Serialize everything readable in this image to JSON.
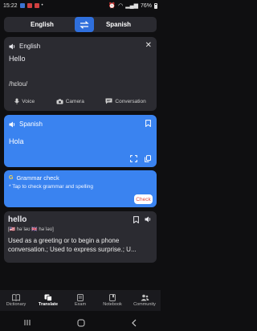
{
  "status": {
    "time": "15:22",
    "battery": "76%"
  },
  "lang_bar": {
    "source": "English",
    "target": "Spanish"
  },
  "source_card": {
    "language": "English",
    "text": "Hello",
    "phonetic": "/hɛlou/",
    "actions": [
      "Voice",
      "Camera",
      "Conversation"
    ]
  },
  "target_card": {
    "language": "Spanish",
    "text": "Hola"
  },
  "grammar": {
    "title": "Grammar check",
    "tip": "* Tap to check grammar and spelling",
    "button": "Check"
  },
  "dictionary": {
    "word": "hello",
    "phonetic": "[🇺🇸 həˈləʊ 🇬🇧 həˈləʊ]",
    "definition": "Used as a greeting or to begin a phone conversation.; Used to express surprise.; U..."
  },
  "bottom_nav": {
    "items": [
      "Dictionary",
      "Translate",
      "Exam",
      "Notebook",
      "Community"
    ],
    "active": "Translate"
  },
  "colors": {
    "accent": "#3a83f0",
    "swap": "#2f6fdc",
    "card": "#2b2b31",
    "check_text": "#e0463c"
  },
  "icons": [
    "swap-icon",
    "speaker-icon",
    "close-icon",
    "mic-icon",
    "camera-icon",
    "chat-icon",
    "bookmark-icon",
    "expand-icon",
    "copy-icon"
  ]
}
